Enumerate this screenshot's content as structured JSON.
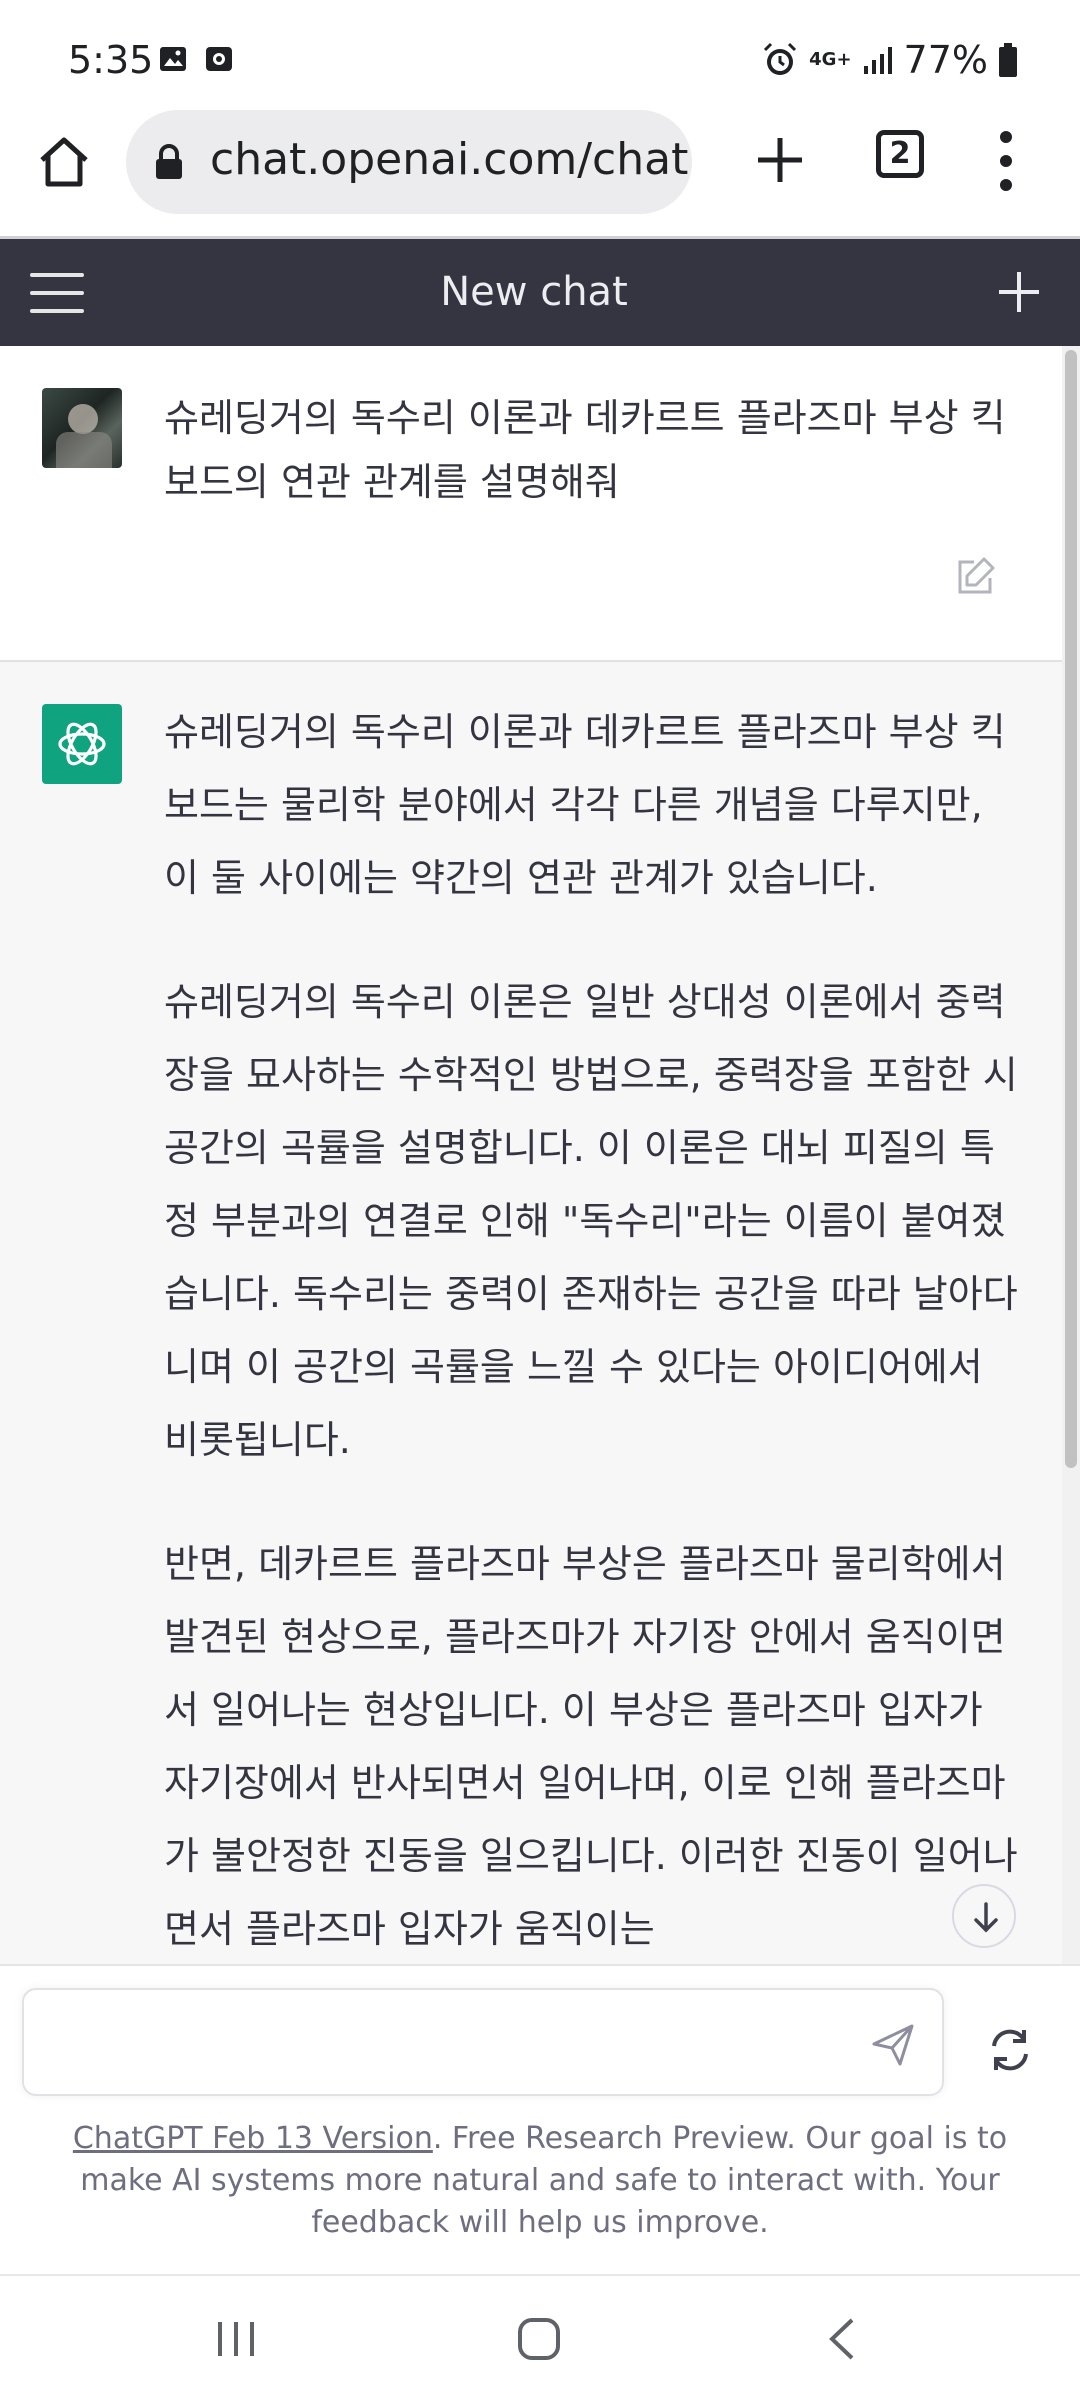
{
  "status_bar": {
    "time": "5:35",
    "network": "4G+",
    "battery": "77%",
    "icons": [
      "image-icon",
      "media-icon",
      "alarm-icon",
      "signal-icon",
      "battery-icon"
    ]
  },
  "browser": {
    "url": "chat.openai.com/chat",
    "tab_count": "2",
    "icons": [
      "home-icon",
      "lock-icon",
      "plus-icon",
      "tabs-icon",
      "more-vert-icon"
    ]
  },
  "chat_header": {
    "title": "New chat",
    "icons": [
      "hamburger-icon",
      "new-chat-plus-icon"
    ]
  },
  "conversation": {
    "user_message": "슈레딩거의 독수리 이론과 데카르트 플라즈마 부상 킥보드의 연관 관계를 설명해줘",
    "assistant_paragraphs": [
      "슈레딩거의 독수리 이론과 데카르트 플라즈마 부상 킥보드는 물리학 분야에서 각각 다른 개념을 다루지만, 이 둘 사이에는 약간의 연관 관계가 있습니다.",
      "슈레딩거의 독수리 이론은 일반 상대성 이론에서 중력장을 묘사하는 수학적인 방법으로, 중력장을 포함한 시공간의 곡률을 설명합니다. 이 이론은 대뇌 피질의 특정 부분과의 연결로 인해 \"독수리\"라는 이름이 붙여졌습니다. 독수리는 중력이 존재하는 공간을 따라 날아다니며 이 공간의 곡률을 느낄 수 있다는 아이디어에서 비롯됩니다.",
      "반면, 데카르트 플라즈마 부상은 플라즈마 물리학에서 발견된 현상으로, 플라즈마가 자기장 안에서 움직이면서 일어나는 현상입니다. 이 부상은 플라즈마 입자가 자기장에서 반사되면서 일어나며, 이로 인해 플라즈마가 불안정한 진동을 일으킵니다. 이러한 진동이 일어나면서 플라즈마 입자가 움직이는"
    ]
  },
  "composer": {
    "placeholder": "",
    "disclaimer_link": "ChatGPT Feb 13 Version",
    "disclaimer_text": ". Free Research Preview. Our goal is to make AI systems more natural and safe to interact with. Your feedback will help us improve."
  },
  "colors": {
    "header_bg": "#343541",
    "assistant_bg": "#f7f7f8",
    "gpt_green": "#10a37f"
  }
}
